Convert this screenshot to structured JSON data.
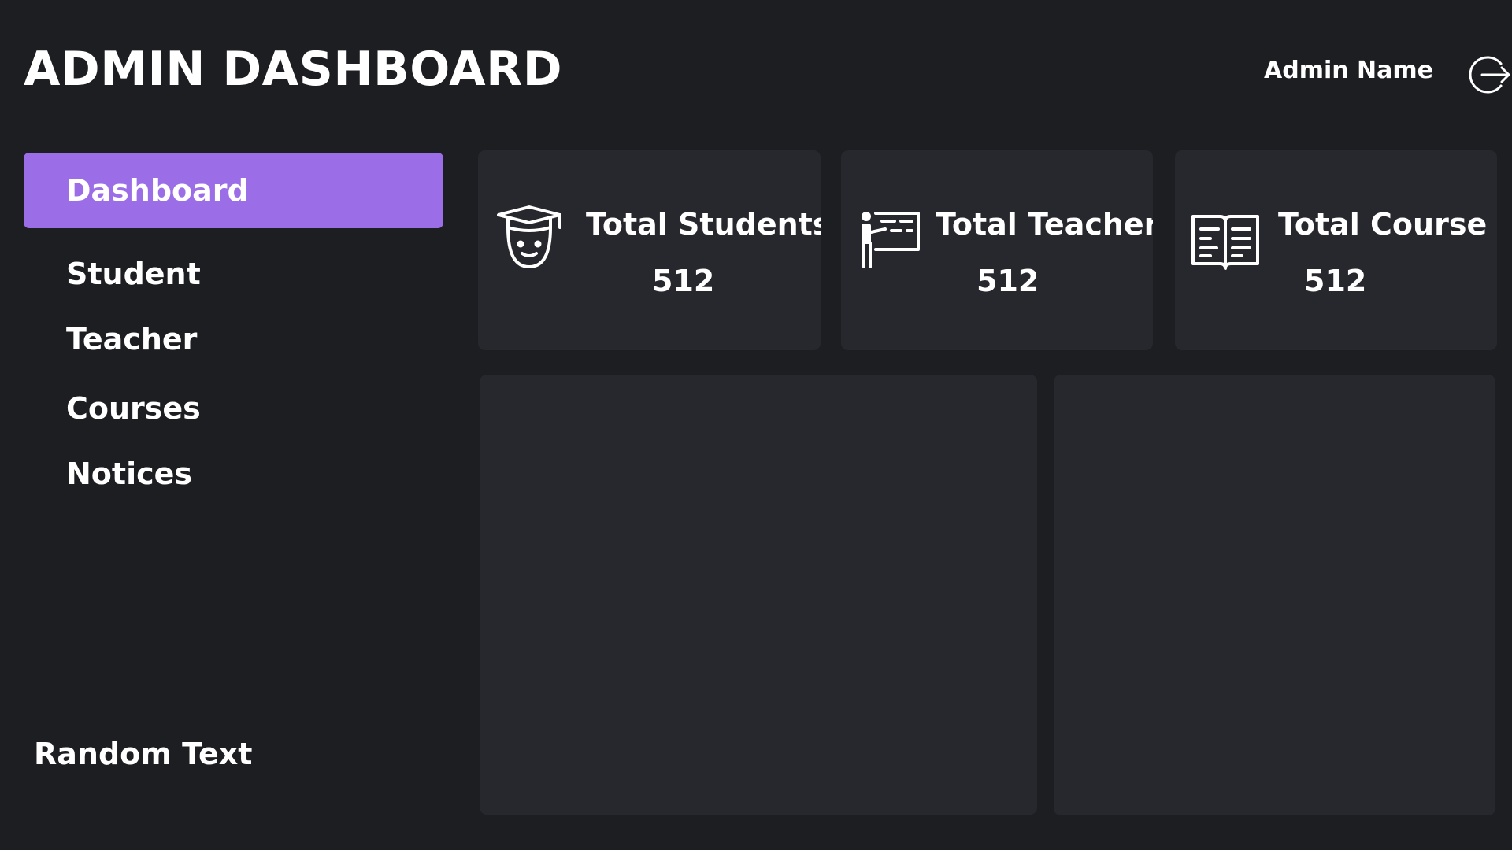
{
  "header": {
    "title": "ADMIN DASHBOARD",
    "admin_name": "Admin Name",
    "logout_icon": "logout-icon"
  },
  "sidebar": {
    "items": [
      {
        "label": "Dashboard",
        "active": true
      },
      {
        "label": "Student",
        "active": false
      },
      {
        "label": "Teacher",
        "active": false
      },
      {
        "label": "Courses",
        "active": false
      },
      {
        "label": "Notices",
        "active": false
      }
    ],
    "footer_text": "Random Text"
  },
  "stats": [
    {
      "label": "Total Students",
      "value": "512",
      "icon": "graduate-student-icon"
    },
    {
      "label": "Total Teachers",
      "value": "512",
      "icon": "teacher-board-icon"
    },
    {
      "label": "Total Course",
      "value": "512",
      "icon": "open-book-icon"
    }
  ],
  "colors": {
    "background": "#1d1e22",
    "card": "#27272e",
    "accent": "#9b6de6",
    "text": "#ffffff"
  }
}
